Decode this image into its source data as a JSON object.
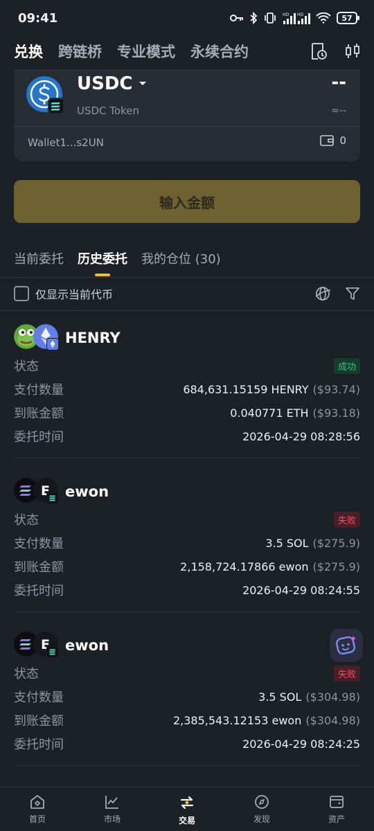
{
  "status_bar": {
    "time": "09:41",
    "battery": "57"
  },
  "top_nav": {
    "tabs": [
      "兑换",
      "跨链桥",
      "专业模式",
      "永续合约"
    ],
    "active_tab": 0
  },
  "token_card": {
    "symbol": "USDC",
    "name": "USDC Token",
    "amount": "--",
    "fiat": "≈--",
    "wallet": "Wallet1...s2UN",
    "wallet_balance": "0"
  },
  "amount_button": {
    "label": "输入金额"
  },
  "order_tabs": [
    "当前委托",
    "历史委托",
    "我的仓位 (30)"
  ],
  "filter": {
    "label": "仅显示当前代币"
  },
  "labels": {
    "status": "状态",
    "paid": "支付数量",
    "received": "到账金额",
    "time": "委托时间"
  },
  "orders": [
    {
      "title": "HENRY",
      "status": "成功",
      "paid": "684,631.15159 HENRY",
      "paid_fiat": "($93.74)",
      "received": "0.040771 ETH",
      "received_fiat": "($93.18)",
      "time": "2026-04-29 08:28:56"
    },
    {
      "title": "ewon",
      "avatar_letter": "E",
      "status": "失败",
      "paid": "3.5 SOL",
      "paid_fiat": "($275.9)",
      "received": "2,158,724.17866 ewon",
      "received_fiat": "($275.9)",
      "time": "2026-04-29 08:24:55"
    },
    {
      "title": "ewon",
      "avatar_letter": "E",
      "status": "失败",
      "paid": "3.5 SOL",
      "paid_fiat": "($304.98)",
      "received": "2,385,543.12153 ewon",
      "received_fiat": "($304.98)",
      "time": "2026-04-29 08:24:25"
    }
  ],
  "bottom_nav": [
    "首页",
    "市场",
    "交易",
    "发现",
    "资产"
  ],
  "colors": {
    "background": "#1c2027",
    "card": "#272c35",
    "accent": "#f0c420",
    "success": "#32c380",
    "fail": "#f0506a"
  }
}
